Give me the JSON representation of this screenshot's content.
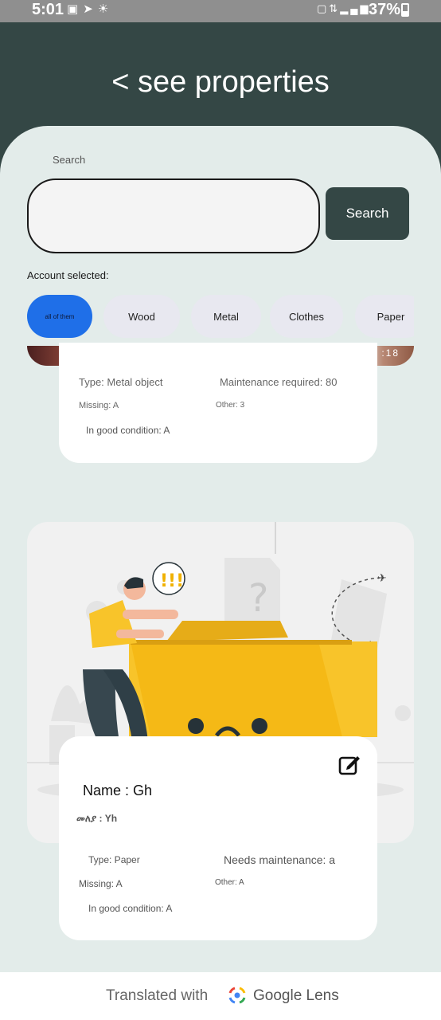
{
  "status_bar": {
    "time": "5:01",
    "battery": "37%",
    "left_icons": [
      "image-icon",
      "telegram-icon",
      "notification-icon"
    ],
    "right_icons": [
      "lock-icon",
      "data-icon",
      "signal-icon",
      "battery-icon"
    ]
  },
  "header": {
    "title": "< see properties"
  },
  "search": {
    "label": "Search",
    "value": "",
    "button_label": "Search"
  },
  "accounts": {
    "label": "Account selected:",
    "chips": [
      {
        "label": "all of them",
        "active": true
      },
      {
        "label": "Wood",
        "active": false
      },
      {
        "label": "Metal",
        "active": false
      },
      {
        "label": "Clothes",
        "active": false
      },
      {
        "label": "Paper",
        "active": false
      }
    ]
  },
  "items": [
    {
      "image_label": ":18",
      "type": "Type: Metal object",
      "maintenance": "Maintenance required: 80",
      "missing": "Missing: A",
      "other": "Other: 3",
      "condition": "In good condition: A"
    },
    {
      "image_text": "!!!",
      "name": "Name : Gh",
      "amharic_name": "መለያ : Yh",
      "type": "Type: Paper",
      "maintenance": "Needs maintenance: a",
      "missing": "Missing: A",
      "other": "Other: A",
      "condition": "In good condition: A",
      "edit_icon": "edit-icon"
    }
  ],
  "footer": {
    "text": "Translated with",
    "brand": "Google Lens"
  },
  "colors": {
    "header_bg": "#344745",
    "panel_bg": "#e3ecea",
    "active_chip": "#1f6fe8",
    "search_button": "#344745",
    "folder_yellow": "#f8c42a"
  }
}
